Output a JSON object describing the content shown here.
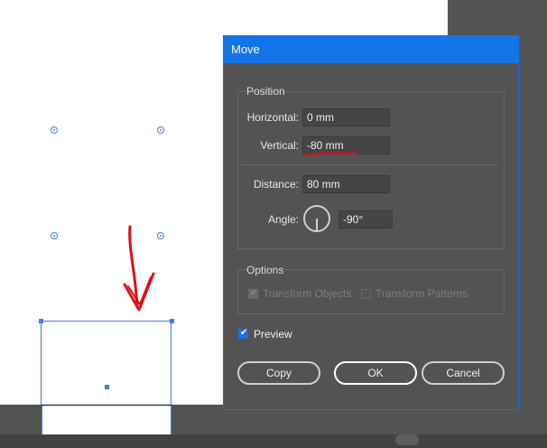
{
  "dialog": {
    "title": "Move",
    "position": {
      "group_title": "Position",
      "horizontal_label": "Horizontal:",
      "horizontal_value": "0 mm",
      "vertical_label": "Vertical:",
      "vertical_value": "-80 mm",
      "distance_label": "Distance:",
      "distance_value": "80 mm",
      "angle_label": "Angle:",
      "angle_value": "-90°"
    },
    "options": {
      "group_title": "Options",
      "transform_objects_label": "Transform Objects",
      "transform_objects_checked": true,
      "transform_patterns_label": "Transform Patterns",
      "transform_patterns_checked": false
    },
    "preview_label": "Preview",
    "preview_checked": true,
    "buttons": {
      "copy": "Copy",
      "ok": "OK",
      "cancel": "Cancel"
    }
  },
  "colors": {
    "accent": "#1473e6",
    "selection": "#4a78e0",
    "annotation": "#e01010"
  },
  "icons": {
    "angle_dial": "angle-dial-icon",
    "annotation_arrow": "down-arrow-annotation"
  }
}
